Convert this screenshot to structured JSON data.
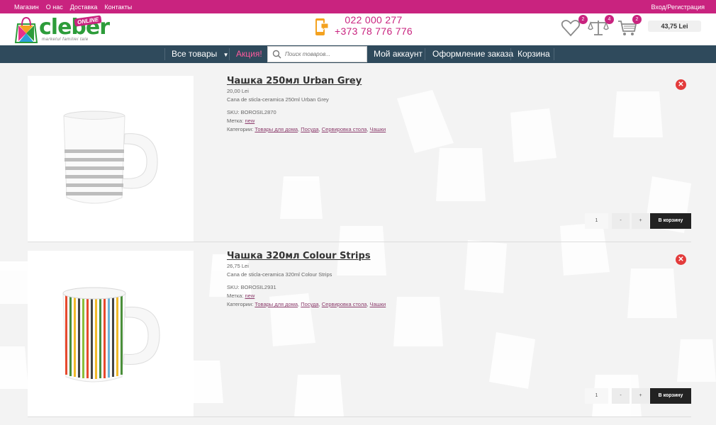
{
  "topbar": {
    "links": [
      "Магазин",
      "О нас",
      "Доставка",
      "Контакты"
    ],
    "login": "Вход/Регистрация"
  },
  "header": {
    "logo_text": "cleber",
    "logo_badge": "ONLINE",
    "logo_tagline": "marketul familiei tale",
    "phone_1": "022 000 277",
    "phone_2": "+373 78 776 776",
    "wishlist_count": "2",
    "compare_count": "4",
    "cart_count": "2",
    "cart_total": "43,75 Lei"
  },
  "nav": {
    "all_products": "Все товары",
    "promo": "Акция!",
    "search_placeholder": "Поиск товаров...",
    "account": "Мой аккаунт",
    "checkout": "Оформление заказа",
    "cart": "Корзина"
  },
  "colors": {
    "brand_pink": "#c9237f",
    "nav_bg": "#2f4a5c",
    "logo_green": "#2d9c3a"
  },
  "products": [
    {
      "title": "Чашка 250мл Urban Grey",
      "price": "20,00 Lei",
      "description": "Cana de sticla-ceramica 250ml Urban Grey",
      "sku": "SKU: BOROSIL2870",
      "tag_label": "Метка:",
      "tag": "new",
      "cat_label": "Категории:",
      "categories": [
        "Товары для дома",
        "Посуда",
        "Сервировка стола",
        "Чашки"
      ],
      "qty": "1",
      "minus": "-",
      "plus": "+",
      "add_to_cart": "В корзину"
    },
    {
      "title": "Чашка 320мл Colour Strips",
      "price": "26,75 Lei",
      "description": "Cana de sticla-ceramica 320ml Colour Strips",
      "sku": "SKU: BOROSIL2931",
      "tag_label": "Метка:",
      "tag": "new",
      "cat_label": "Категории:",
      "categories": [
        "Товары для дома",
        "Посуда",
        "Сервировка стола",
        "Чашки"
      ],
      "qty": "1",
      "minus": "-",
      "plus": "+",
      "add_to_cart": "В корзину"
    }
  ]
}
